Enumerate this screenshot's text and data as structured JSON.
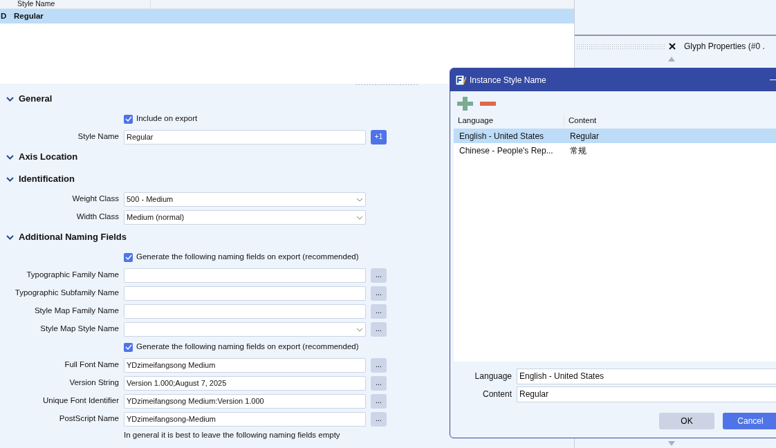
{
  "styles_list": {
    "columns": [
      "Style Name"
    ],
    "rows": [
      {
        "marker": "D",
        "name": "Regular",
        "selected": true
      }
    ]
  },
  "sections": [
    {
      "title": "General",
      "expanded": true,
      "rows": [
        {
          "kind": "checkbox",
          "label": "Include on export",
          "checked": true
        },
        {
          "kind": "text",
          "label": "Style Name",
          "value": "Regular",
          "button": "+1"
        }
      ]
    },
    {
      "title": "Axis Location",
      "expanded": true
    },
    {
      "title": "Identification",
      "expanded": true,
      "rows": [
        {
          "kind": "select",
          "label": "Weight Class",
          "value": "500 - Medium"
        },
        {
          "kind": "select",
          "label": "Width Class",
          "value": "Medium (normal)"
        }
      ]
    },
    {
      "title": "Additional Naming Fields",
      "expanded": true,
      "rows": [
        {
          "kind": "checkbox",
          "label": "Generate the following naming fields on export (recommended)",
          "checked": true
        },
        {
          "kind": "text",
          "label": "Typographic Family Name",
          "button": "..."
        },
        {
          "kind": "text",
          "label": "Typographic Subfamily Name",
          "button": "..."
        },
        {
          "kind": "text",
          "label": "Style Map Family Name",
          "button": "..."
        },
        {
          "kind": "select",
          "label": "Style Map Style Name",
          "button": "..."
        },
        {
          "kind": "checkbox",
          "label": "Generate the following naming fields on export (recommended)",
          "checked": true
        },
        {
          "kind": "text",
          "label": "Full Font Name",
          "value": "YDzimeifangsong Medium",
          "button": "..."
        },
        {
          "kind": "text",
          "label": "Version String",
          "value": "Version 1.000;August 7, 2025",
          "button": "..."
        },
        {
          "kind": "text",
          "label": "Unique Font Identifier",
          "value": "YDzimeifangsong Medium:Version 1.000",
          "button": "..."
        },
        {
          "kind": "text",
          "label": "PostScript Name",
          "value": "YDzimeifangsong-Medium",
          "button": "..."
        },
        {
          "kind": "note",
          "label": "In general it is best to leave the following naming fields empty"
        }
      ]
    }
  ],
  "side_panel": {
    "title": "Glyph Properties (#0 ."
  },
  "dialog": {
    "title": "Instance Style Name",
    "columns": [
      "Language",
      "Content"
    ],
    "rows": [
      {
        "language": "English - United States",
        "content": "Regular",
        "selected": true
      },
      {
        "language": "Chinese - People's Rep...",
        "content": "常规",
        "selected": false
      }
    ],
    "fields": [
      {
        "label": "Language",
        "value": "English - United States"
      },
      {
        "label": "Content",
        "value": "Regular"
      }
    ],
    "buttons": [
      {
        "label": "OK",
        "kind": "secondary"
      },
      {
        "label": "Cancel",
        "kind": "primary"
      }
    ]
  }
}
